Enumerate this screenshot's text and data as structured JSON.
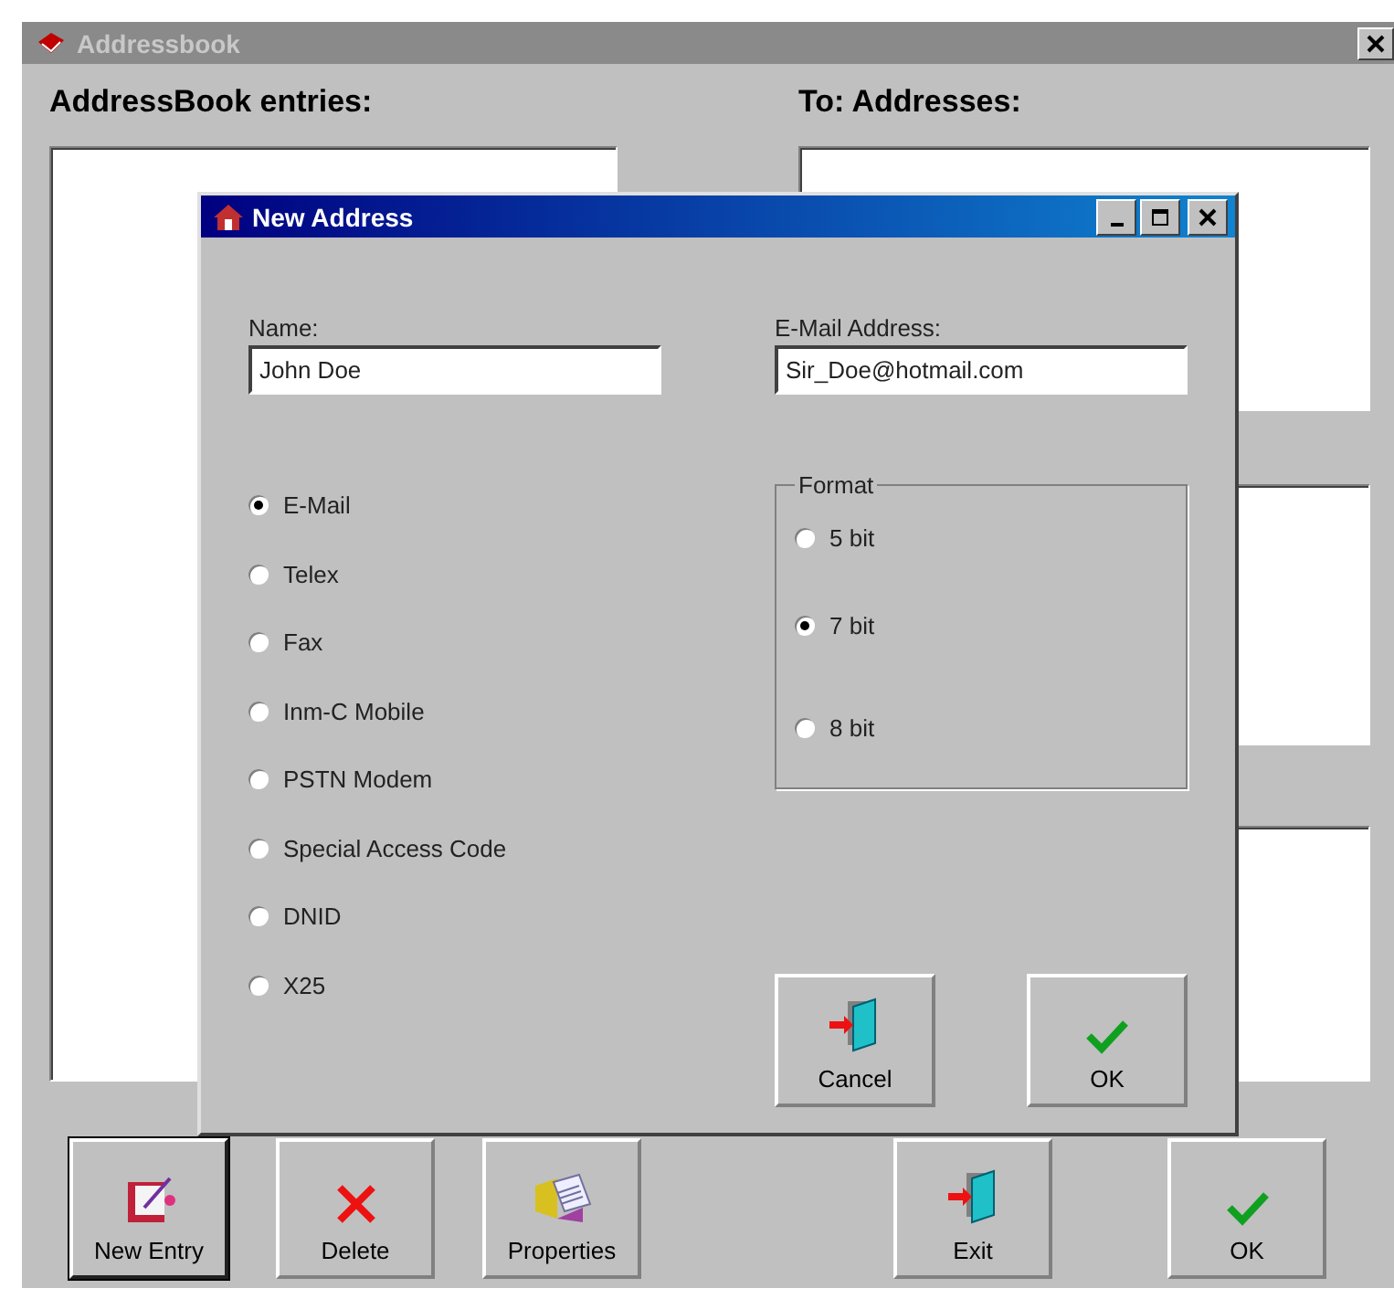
{
  "window": {
    "title": "Addressbook"
  },
  "left_list": {
    "label": "AddressBook entries:"
  },
  "right_list": {
    "label": "To: Addresses:"
  },
  "dialog": {
    "title": "New Address",
    "name": {
      "label": "Name:",
      "value": "John Doe"
    },
    "email": {
      "label": "E-Mail Address:",
      "value": "Sir_Doe@hotmail.com"
    },
    "types": [
      {
        "label": "E-Mail",
        "selected": true
      },
      {
        "label": "Telex",
        "selected": false
      },
      {
        "label": "Fax",
        "selected": false
      },
      {
        "label": "Inm-C Mobile",
        "selected": false
      },
      {
        "label": "PSTN Modem",
        "selected": false
      },
      {
        "label": "Special Access Code",
        "selected": false
      },
      {
        "label": "DNID",
        "selected": false
      },
      {
        "label": "X25",
        "selected": false
      }
    ],
    "format": {
      "label": "Format",
      "options": [
        {
          "label": "5 bit",
          "selected": false
        },
        {
          "label": "7 bit",
          "selected": true
        },
        {
          "label": "8 bit",
          "selected": false
        }
      ]
    },
    "buttons": [
      {
        "label": "Cancel",
        "kind": "door"
      },
      {
        "label": "OK",
        "kind": "check"
      }
    ]
  },
  "toolbar": [
    {
      "label": "New Entry",
      "kind": "notebook",
      "focused": true
    },
    {
      "label": "Delete",
      "kind": "cross",
      "focused": false
    },
    {
      "label": "Properties",
      "kind": "folder",
      "focused": false
    },
    {
      "label": "Exit",
      "kind": "door",
      "focused": false
    },
    {
      "label": "OK",
      "kind": "check",
      "focused": false
    }
  ]
}
